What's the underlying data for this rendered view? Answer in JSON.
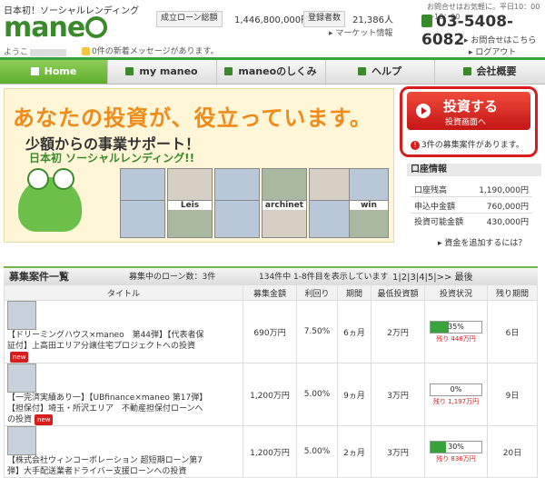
{
  "header": {
    "tagline": "日本初！ソーシャルレンディング",
    "logo": "mane",
    "greeting_prefix": "ようこ",
    "message": "0件の新着メッセージがあります。",
    "loan_total_label": "成立ローン総額",
    "loan_total_value": "1,446,800,000円",
    "members_label": "登録者数",
    "members_value": "21,386人",
    "market_link": "▸ マーケット情報",
    "tel_hours": "お問合せはお気軽に。平日10：00～18：00",
    "tel": "03-5408-6082",
    "inquiry_link": "▸ お問合せはこちら",
    "logout_link": "▸ ログアウト"
  },
  "nav": {
    "items": [
      {
        "label": "Home"
      },
      {
        "label": "my maneo"
      },
      {
        "label": "maneoのしくみ"
      },
      {
        "label": "ヘルプ"
      },
      {
        "label": "会社概要"
      }
    ]
  },
  "banner": {
    "title": "あなたの投資が、役立っています。",
    "sub": "少額からの事業サポート！",
    "sub2": "日本初 ソーシャルレンディング!!",
    "photo_labels": [
      "Leis",
      "archinet",
      "win"
    ]
  },
  "invest": {
    "button_main": "投資する",
    "button_sub": "投資画面へ",
    "note": "3件の募集案件があります。"
  },
  "account": {
    "heading": "口座情報",
    "rows": [
      {
        "label": "口座残高",
        "value": "1,190,000円"
      },
      {
        "label": "申込中金額",
        "value": "760,000円"
      },
      {
        "label": "投資可能金額",
        "value": "430,000円"
      }
    ],
    "link": "▸ 資金を追加するには？"
  },
  "section": {
    "title": "募集案件一覧",
    "info": "募集中のローン数：3件",
    "range": "134件中 1-8件目を表示しています",
    "pages": "1|2|3|4|5|>> 最後"
  },
  "table": {
    "headers": [
      "タイトル",
      "募集金額",
      "利回り",
      "期間",
      "最低投資額",
      "投資状況",
      "残り期間"
    ],
    "rows": [
      {
        "title": "【ドリーミングハウス×maneo　第44弾】【代表者保証付】上高田エリア分譲住宅プロジェクトへの投資",
        "new": "new",
        "amount": "690万円",
        "rate": "7.50%",
        "term": "6ヵ月",
        "min": "2万円",
        "progress": 35,
        "progress_label": "35%",
        "remain": "残り 448万円",
        "days": "6日"
      },
      {
        "title": "【一完済実績あり一】【UBfinance×maneo 第17弾】【担保付】埼玉・所沢エリア　不動産担保付ローンへの投資",
        "new": "new",
        "amount": "1,200万円",
        "rate": "5.00%",
        "term": "9ヵ月",
        "min": "3万円",
        "progress": 0,
        "progress_label": "0%",
        "remain": "残り 1,197万円",
        "days": "9日"
      },
      {
        "title": "【株式会社ウィンコーポレーション 超短期ローン第7弾】大手配送業者ドライバー支援ローンへの投資",
        "new": "",
        "amount": "1,200万円",
        "rate": "5.00%",
        "term": "2ヵ月",
        "min": "3万円",
        "progress": 30,
        "progress_label": "30%",
        "remain": "残り 836万円",
        "days": "20日"
      }
    ]
  },
  "colors": {
    "brand": "#3a8a2c",
    "accent": "#d91c1c",
    "banner_title": "#f08a18"
  }
}
